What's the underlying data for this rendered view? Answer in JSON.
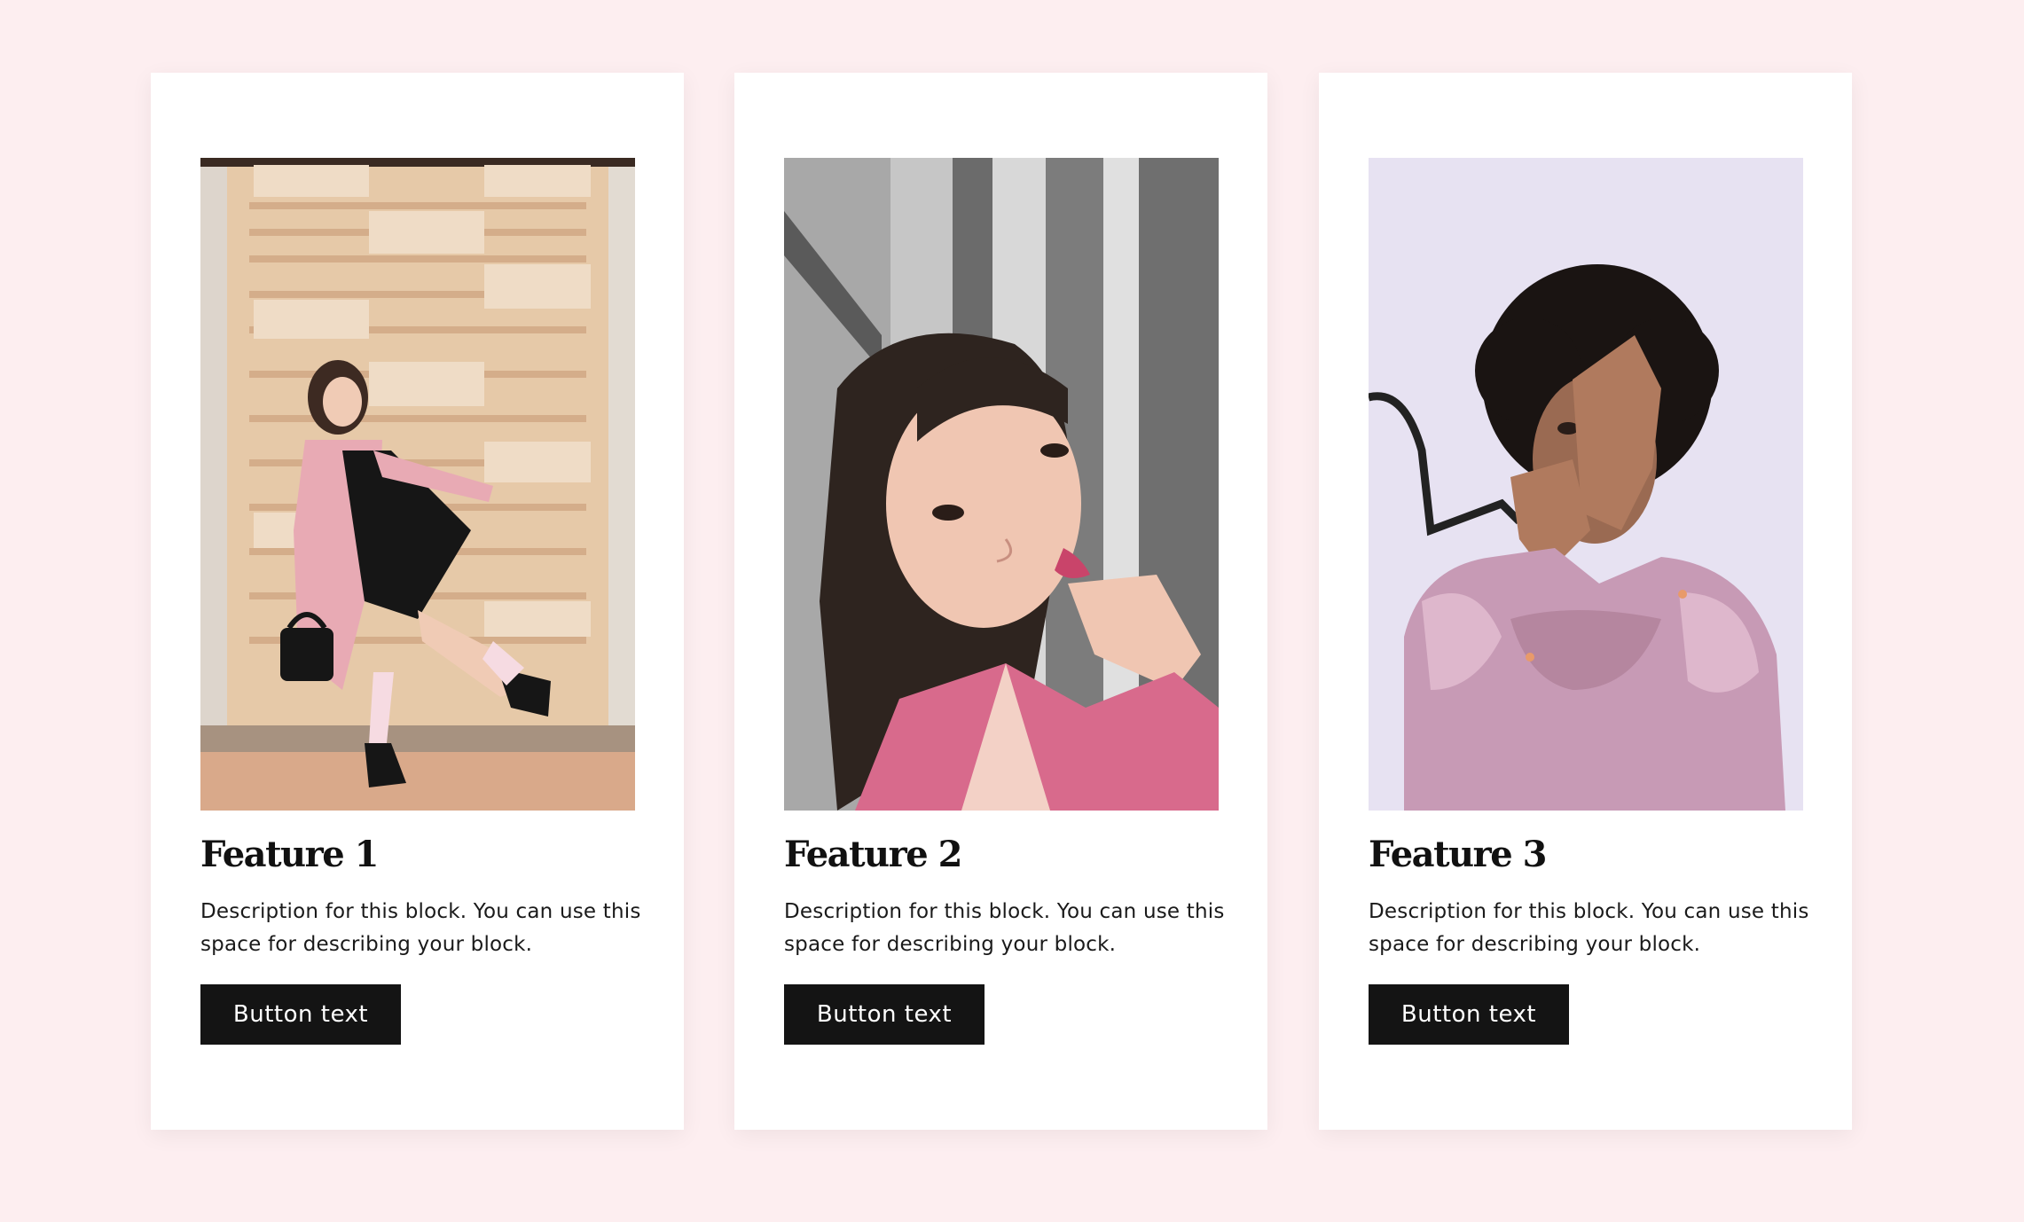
{
  "cards": [
    {
      "image_alt": "woman in pink coat posing against a tiled wall",
      "title": "Feature 1",
      "description": "Description for this block. You can use this space for describing your block.",
      "button_label": "Button text"
    },
    {
      "image_alt": "woman with pink jacket resting chin on hand on stairs",
      "title": "Feature 2",
      "description": "Description for this block. You can use this space for describing your block.",
      "button_label": "Button text"
    },
    {
      "image_alt": "woman with curly hair in pink satin blouse covering face",
      "title": "Feature 3",
      "description": "Description for this block. You can use this space for describing your block.",
      "button_label": "Button text"
    }
  ],
  "colors": {
    "page_background": "#fdeef0",
    "card_background": "#ffffff",
    "button_background": "#141414",
    "button_text": "#ffffff"
  }
}
